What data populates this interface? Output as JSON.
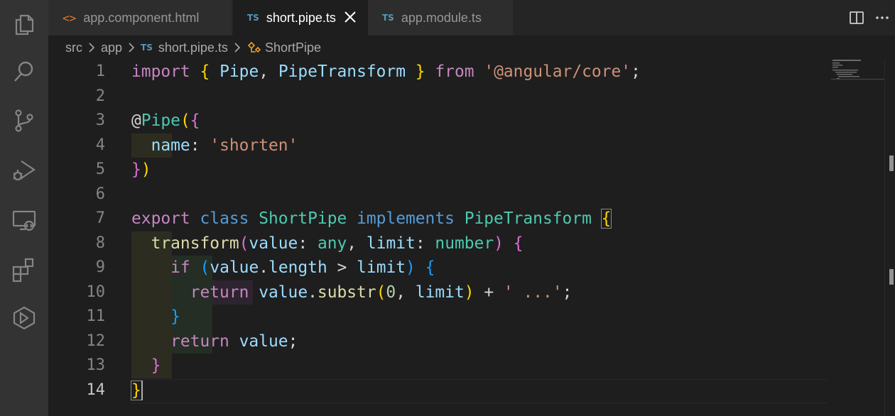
{
  "tabs": [
    {
      "label": "app.component.html",
      "icon": "html-brackets-icon",
      "active": false
    },
    {
      "label": "short.pipe.ts",
      "icon": "TS",
      "active": true
    },
    {
      "label": "app.module.ts",
      "icon": "TS",
      "active": false
    }
  ],
  "breadcrumb": {
    "items": [
      "src",
      "app",
      "short.pipe.ts",
      "ShortPipe"
    ],
    "ts_badge": "TS"
  },
  "editor": {
    "language": "typescript",
    "current_line": 14,
    "line_numbers": [
      "1",
      "2",
      "3",
      "4",
      "5",
      "6",
      "7",
      "8",
      "9",
      "10",
      "11",
      "12",
      "13",
      "14"
    ],
    "lines": [
      "import { Pipe, PipeTransform } from '@angular/core';",
      "",
      "@Pipe({",
      "  name: 'shorten'",
      "})",
      "",
      "export class ShortPipe implements PipeTransform {",
      "  transform(value: any, limit: number) {",
      "    if (value.length > limit) {",
      "      return value.substr(0, limit) + ' ...';",
      "    }",
      "    return value;",
      "  }",
      "}"
    ]
  },
  "activity_bar": [
    "files-icon",
    "search-icon",
    "source-control-icon",
    "run-debug-icon",
    "remote-explorer-icon",
    "extensions-icon",
    "angular-icon"
  ],
  "colors": {
    "keyword": "#c586c0",
    "storage": "#569cd6",
    "variable": "#9cdcfe",
    "type": "#4ec9b0",
    "function": "#dcdcaa",
    "string": "#ce9178",
    "number": "#b5cea8",
    "bracket_1": "#ffd700",
    "bracket_2": "#da70d6",
    "bracket_3": "#179fff"
  }
}
